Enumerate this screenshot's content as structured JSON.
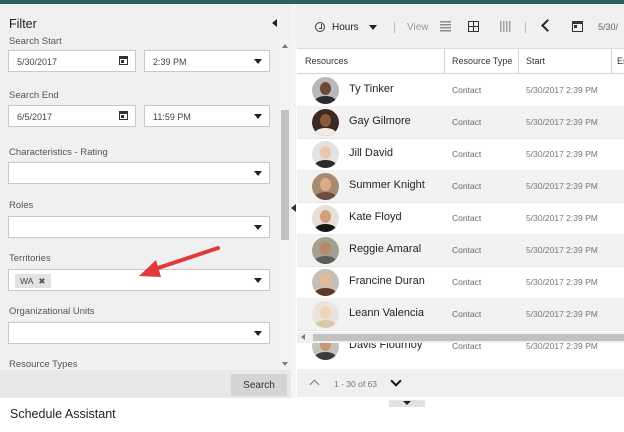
{
  "filter": {
    "title": "Filter",
    "search_start": {
      "label": "Search Start",
      "date": "5/30/2017",
      "time": "2:39 PM"
    },
    "search_end": {
      "label": "Search End",
      "date": "6/5/2017",
      "time": "11:59 PM"
    },
    "characteristics_label": "Characteristics - Rating",
    "roles_label": "Roles",
    "territories_label": "Territories",
    "territories_tag": "WA",
    "territories_tag_remove": "✖",
    "org_units_label": "Organizational Units",
    "resource_types_label": "Resource Types",
    "search_button": "Search",
    "icons": [
      "calendar-icon",
      "chevron-down-icon",
      "collapse-left-icon",
      "remove-tag-icon"
    ]
  },
  "toolbar": {
    "hours_label": "Hours",
    "view_label": "View",
    "date_partial": "5/30/",
    "icons": [
      "clock-icon",
      "list-view-icon",
      "grid-view-icon",
      "columns-view-icon",
      "previous-icon",
      "calendar-icon"
    ]
  },
  "grid": {
    "columns": [
      "Resources",
      "Resource Type",
      "Start",
      "Es"
    ],
    "rows": [
      {
        "name": "Ty Tinker",
        "type": "Contact",
        "start": "5/30/2017 2:39 PM",
        "skin": "#6b4a34",
        "shirt": "#2b2b2b",
        "bg": "#b9b9b9"
      },
      {
        "name": "Gay Gilmore",
        "type": "Contact",
        "start": "5/30/2017 2:39 PM",
        "skin": "#8a5a3c",
        "shirt": "#f0ebe4",
        "bg": "#3a2a22"
      },
      {
        "name": "Jill David",
        "type": "Contact",
        "start": "5/30/2017 2:39 PM",
        "skin": "#e7c9ae",
        "shirt": "#2a2a2a",
        "bg": "#e2e2e2"
      },
      {
        "name": "Summer Knight",
        "type": "Contact",
        "start": "5/30/2017 2:39 PM",
        "skin": "#d9ad8a",
        "shirt": "#6b4f3c",
        "bg": "#a88a70"
      },
      {
        "name": "Kate Floyd",
        "type": "Contact",
        "start": "5/30/2017 2:39 PM",
        "skin": "#d3a07e",
        "shirt": "#161616",
        "bg": "#e8e0d8"
      },
      {
        "name": "Reggie Amaral",
        "type": "Contact",
        "start": "5/30/2017 2:39 PM",
        "skin": "#b88768",
        "shirt": "#5d5d5d",
        "bg": "#a4a090"
      },
      {
        "name": "Francine Duran",
        "type": "Contact",
        "start": "5/30/2017 2:39 PM",
        "skin": "#e2bc98",
        "shirt": "#5c3a24",
        "bg": "#c7bfb5"
      },
      {
        "name": "Leann Valencia",
        "type": "Contact",
        "start": "5/30/2017 2:39 PM",
        "skin": "#f0d4b8",
        "shirt": "#d9c9a8",
        "bg": "#e9e4dc"
      },
      {
        "name": "Davis Flournoy",
        "type": "Contact",
        "start": "5/30/2017 2:39 PM",
        "skin": "#c59878",
        "shirt": "#3c3c3c",
        "bg": "#c8c2bb"
      }
    ]
  },
  "pager": {
    "range": "1 - 30 of 63"
  },
  "footer": {
    "title": "Schedule Assistant"
  },
  "colors": {
    "top_bar": "#2d5e61",
    "annotation_arrow": "#e03a3a",
    "panel_bg": "#f0f0f0",
    "alt_row": "#f2f2f2"
  }
}
